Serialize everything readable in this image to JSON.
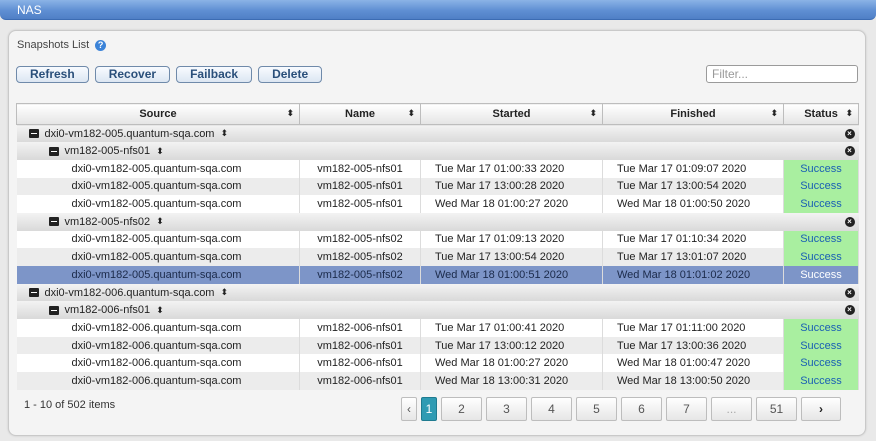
{
  "window": {
    "title": "NAS"
  },
  "panel": {
    "label": "Snapshots List",
    "help_icon": "question-circle-icon"
  },
  "toolbar": {
    "refresh_label": "Refresh",
    "recover_label": "Recover",
    "failback_label": "Failback",
    "delete_label": "Delete"
  },
  "filter": {
    "placeholder": "Filter...",
    "value": ""
  },
  "columns": [
    "Source",
    "Name",
    "Started",
    "Finished",
    "Status"
  ],
  "groups": [
    {
      "label": "dxi0-vm182-005.quantum-sqa.com"
    },
    {
      "label": "vm182-005-nfs01"
    },
    {
      "label": "vm182-005-nfs02"
    },
    {
      "label": "dxi0-vm182-006.quantum-sqa.com"
    },
    {
      "label": "vm182-006-nfs01"
    }
  ],
  "rows": [
    {
      "source": "dxi0-vm182-005.quantum-sqa.com",
      "name": "vm182-005-nfs01",
      "started": "Tue Mar 17 01:00:33 2020",
      "finished": "Tue Mar 17 01:09:07 2020",
      "status": "Success"
    },
    {
      "source": "dxi0-vm182-005.quantum-sqa.com",
      "name": "vm182-005-nfs01",
      "started": "Tue Mar 17 13:00:28 2020",
      "finished": "Tue Mar 17 13:00:54 2020",
      "status": "Success"
    },
    {
      "source": "dxi0-vm182-005.quantum-sqa.com",
      "name": "vm182-005-nfs01",
      "started": "Wed Mar 18 01:00:27 2020",
      "finished": "Wed Mar 18 01:00:50 2020",
      "status": "Success"
    },
    {
      "source": "dxi0-vm182-005.quantum-sqa.com",
      "name": "vm182-005-nfs02",
      "started": "Tue Mar 17 01:09:13 2020",
      "finished": "Tue Mar 17 01:10:34 2020",
      "status": "Success"
    },
    {
      "source": "dxi0-vm182-005.quantum-sqa.com",
      "name": "vm182-005-nfs02",
      "started": "Tue Mar 17 13:00:54 2020",
      "finished": "Tue Mar 17 13:01:07 2020",
      "status": "Success"
    },
    {
      "source": "dxi0-vm182-005.quantum-sqa.com",
      "name": "vm182-005-nfs02",
      "started": "Wed Mar 18 01:00:51 2020",
      "finished": "Wed Mar 18 01:01:02 2020",
      "status": "Success"
    },
    {
      "source": "dxi0-vm182-006.quantum-sqa.com",
      "name": "vm182-006-nfs01",
      "started": "Tue Mar 17 01:00:41 2020",
      "finished": "Tue Mar 17 01:11:00 2020",
      "status": "Success"
    },
    {
      "source": "dxi0-vm182-006.quantum-sqa.com",
      "name": "vm182-006-nfs01",
      "started": "Tue Mar 17 13:00:12 2020",
      "finished": "Tue Mar 17 13:00:36 2020",
      "status": "Success"
    },
    {
      "source": "dxi0-vm182-006.quantum-sqa.com",
      "name": "vm182-006-nfs01",
      "started": "Wed Mar 18 01:00:27 2020",
      "finished": "Wed Mar 18 01:00:47 2020",
      "status": "Success"
    },
    {
      "source": "dxi0-vm182-006.quantum-sqa.com",
      "name": "vm182-006-nfs01",
      "started": "Wed Mar 18 13:00:31 2020",
      "finished": "Wed Mar 18 13:00:50 2020",
      "status": "Success"
    }
  ],
  "selected_row": 6,
  "colors": {
    "success_bg": "#a9efa0",
    "selected_bg": "#7d95c8",
    "current_page_bg": "#2f9bb3",
    "title_bar": "#5f8fd3"
  },
  "footer": {
    "items_text": "1 - 10 of 502 items",
    "pages": [
      "1",
      "2",
      "3",
      "4",
      "5",
      "6",
      "7",
      "...",
      "51"
    ],
    "current_page": "1",
    "prev_symbol": "‹",
    "next_symbol": "›"
  }
}
